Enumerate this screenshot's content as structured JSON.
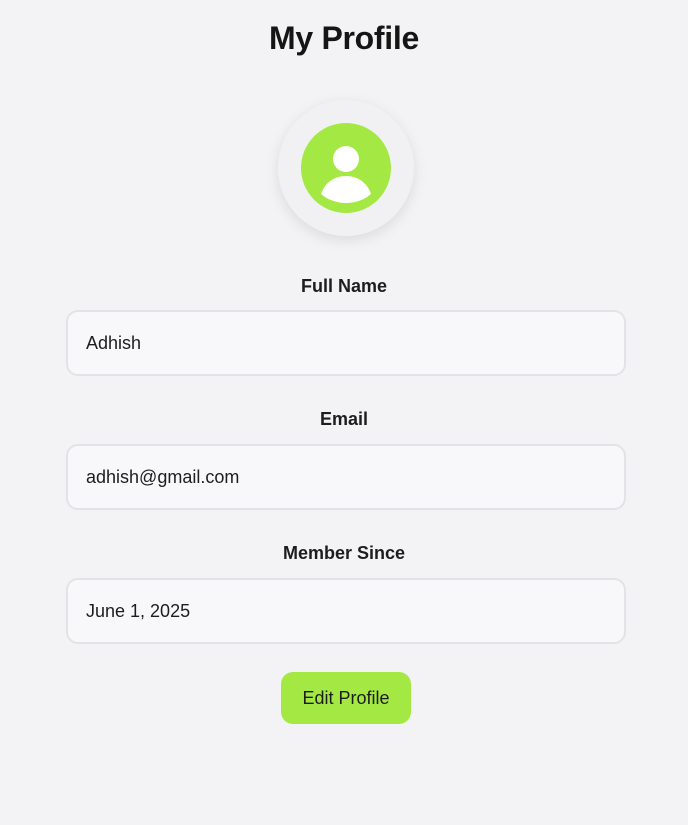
{
  "page": {
    "title": "My Profile"
  },
  "avatar": {
    "icon": "user-avatar-icon",
    "color": "#a4e843"
  },
  "fields": {
    "full_name": {
      "label": "Full Name",
      "value": "Adhish"
    },
    "email": {
      "label": "Email",
      "value": "adhish@gmail.com"
    },
    "member_since": {
      "label": "Member Since",
      "value": "June 1, 2025"
    }
  },
  "actions": {
    "edit_label": "Edit Profile"
  },
  "colors": {
    "accent": "#a4e843",
    "background": "#f3f3f5",
    "field_background": "#f8f8fa",
    "field_border": "#e2e3e6"
  }
}
